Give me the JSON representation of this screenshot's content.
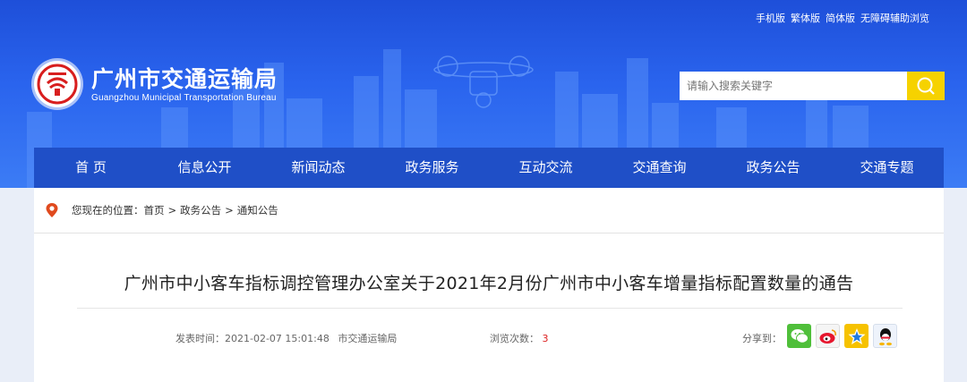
{
  "header": {
    "top_links": [
      "手机版",
      "繁体版",
      "简体版",
      "无障碍辅助浏览"
    ],
    "site_title": "广州市交通运输局",
    "site_title_en": "Guangzhou Municipal Transportation Bureau",
    "search": {
      "placeholder": "请输入搜索关键字"
    }
  },
  "nav": {
    "items": [
      "首 页",
      "信息公开",
      "新闻动态",
      "政务服务",
      "互动交流",
      "交通查询",
      "政务公告",
      "交通专题"
    ]
  },
  "breadcrumb": {
    "label": "您现在的位置：",
    "items": [
      "首页",
      "政务公告",
      "通知公告"
    ],
    "separator": ">"
  },
  "article": {
    "title": "广州市中小客车指标调控管理办公室关于2021年2月份广州市中小客车增量指标配置数量的通告",
    "publish_label": "发表时间：",
    "publish_time": "2021-02-07 15:01:48",
    "publisher": "市交通运输局",
    "views_label": "浏览次数：",
    "views": "3",
    "share_label": "分享到："
  },
  "colors": {
    "header_blue": "#2a64ee",
    "nav_blue": "#1f4fc7",
    "search_button": "#f6d200",
    "logo_red": "#d81e1e"
  },
  "icons": [
    "location-pin-icon",
    "search-icon",
    "wechat-icon",
    "weibo-icon",
    "qzone-icon",
    "qq-icon"
  ]
}
